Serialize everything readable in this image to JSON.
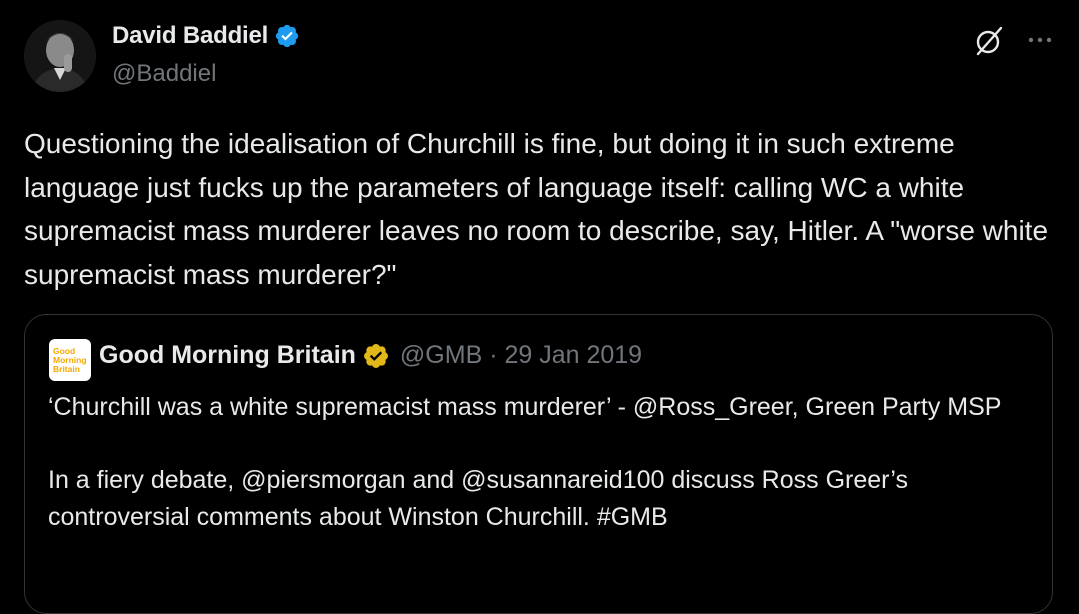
{
  "author": {
    "display_name": "David Baddiel",
    "handle": "@Baddiel"
  },
  "tweet": {
    "text": "Questioning the idealisation of Churchill is fine, but doing it in such extreme language just fucks up the parameters of language itself: calling WC a white supremacist mass murderer leaves no room to describe, say, Hitler. A \"worse white supremacist mass murderer?\""
  },
  "quoted": {
    "logo_lines": [
      "Good",
      "Morning",
      "Britain"
    ],
    "display_name": "Good Morning Britain",
    "meta": "@GMB · 29 Jan 2019",
    "text": "‘Churchill was a white supremacist mass murderer’ - @Ross_Greer, Green Party MSP\n\nIn a fiery debate, @piersmorgan and @susannareid100 discuss Ross Greer’s controversial comments about Winston Churchill. #GMB"
  },
  "icons": {
    "verified": "verified-badge-icon",
    "gold_verified": "gold-verified-badge-icon",
    "grok": "grok-icon",
    "more": "more-icon"
  },
  "colors": {
    "background": "#000000",
    "text": "#e7e9ea",
    "muted": "#71767b",
    "verified_blue": "#1d9bf0",
    "gold": "#e2b719",
    "border": "#2f3336"
  }
}
